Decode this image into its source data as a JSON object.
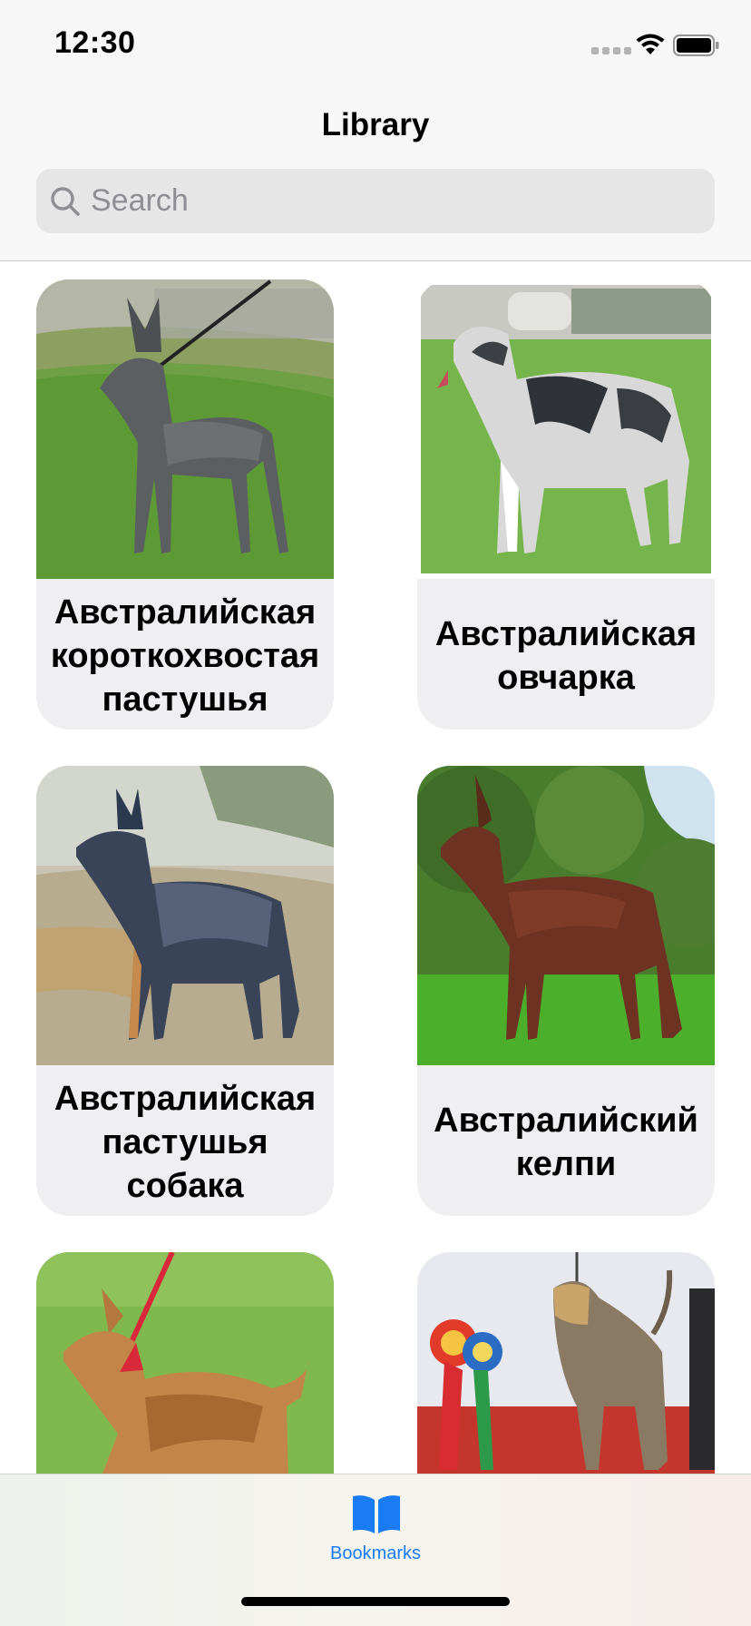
{
  "status_bar": {
    "time": "12:30"
  },
  "nav": {
    "title": "Library"
  },
  "search": {
    "placeholder": "Search",
    "value": ""
  },
  "breeds": [
    {
      "name": "Австралийская короткохвостая пастушья",
      "photo_icon": "grey-cattle-dog-photo"
    },
    {
      "name": "Австралийская овчарка",
      "photo_icon": "merle-shepherd-photo"
    },
    {
      "name": "Австралийская пастушья собака",
      "photo_icon": "blue-heeler-photo"
    },
    {
      "name": "Австралийский келпи",
      "photo_icon": "brown-kelpie-photo"
    },
    {
      "name": "",
      "photo_icon": "terrier-photo"
    },
    {
      "name": "",
      "photo_icon": "silky-terrier-photo"
    }
  ],
  "tab_bar": {
    "items": [
      {
        "label": "Bookmarks",
        "icon": "book-icon",
        "selected": true
      }
    ]
  },
  "colors": {
    "accent": "#1a7cf4",
    "card_background": "#efeff2",
    "header_background": "#f7f7f7"
  }
}
